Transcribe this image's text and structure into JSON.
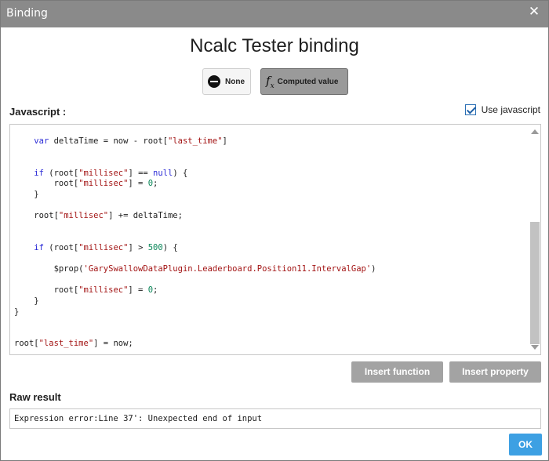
{
  "window": {
    "title": "Binding",
    "close_glyph": "✕"
  },
  "heading": "Ncalc Tester binding",
  "modes": {
    "none_label": "None",
    "computed_label": "Computed value",
    "selected": "Computed value"
  },
  "javascript_label": "Javascript :",
  "use_javascript": {
    "label": "Use javascript",
    "checked": true
  },
  "code_lines": [
    "    var deltaTime = now - root[\"last_time\"]",
    "",
    "",
    "    if (root[\"millisec\"] == null) {",
    "        root[\"millisec\"] = 0;",
    "    }",
    "",
    "    root[\"millisec\"] += deltaTime;",
    "",
    "",
    "    if (root[\"millisec\"] > 500) {",
    "",
    "        $prop('GarySwallowDataPlugin.Leaderboard.Position11.IntervalGap')",
    "",
    "        root[\"millisec\"] = 0;",
    "    }",
    "}",
    "",
    "",
    "root[\"last_time\"] = now;"
  ],
  "buttons": {
    "insert_function": "Insert function",
    "insert_property": "Insert property",
    "ok": "OK"
  },
  "raw_result_label": "Raw result",
  "raw_result_value": "Expression error:Line 37': Unexpected end of input",
  "icons": {
    "none": "no-entry-icon",
    "computed": "function-icon",
    "close": "close-icon"
  },
  "colors": {
    "titlebar": "#8a8a8a",
    "selected_mode": "#9a9a9a",
    "ok_button": "#3da0e3",
    "keyword": "#2b2bd6",
    "string": "#a31515",
    "number": "#098658"
  }
}
